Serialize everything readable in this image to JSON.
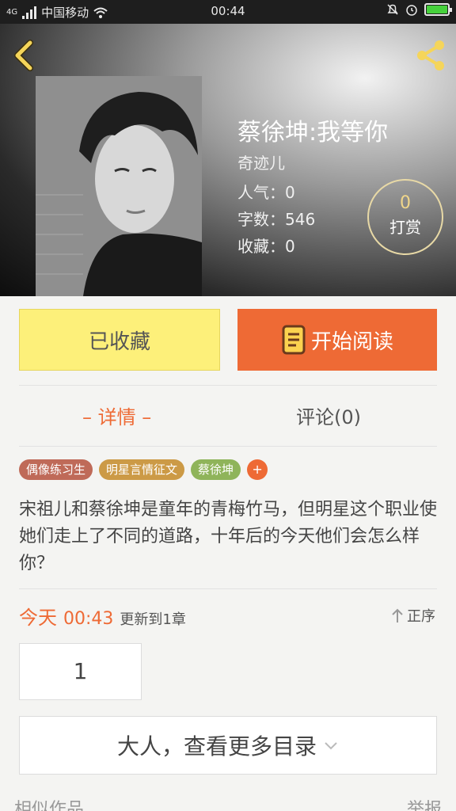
{
  "status_bar": {
    "network": "4G",
    "carrier": "中国移动",
    "time": "00:44"
  },
  "book": {
    "title": "蔡徐坤:我等你",
    "author": "奇迹儿",
    "popularity": "人气：0",
    "word_count": "字数：546",
    "favorites": "收藏：0",
    "tip_count": "0",
    "tip_label": "打赏"
  },
  "actions": {
    "favorite_label": "已收藏",
    "read_label": "开始阅读"
  },
  "tabs": {
    "detail": "– 详情 –",
    "comments": "评论(0)"
  },
  "tags": [
    "偶像练习生",
    "明星言情征文",
    "蔡徐坤"
  ],
  "tag_add": "+",
  "description": "宋祖儿和蔡徐坤是童年的青梅竹马，但明星这个职业使她们走上了不同的道路，十年后的今天他们会怎么样你？",
  "update": {
    "day": "今天",
    "time": "00:43",
    "text": "更新到1章",
    "order_label": "正序"
  },
  "chapters": [
    "1"
  ],
  "more_catalog": "大人，查看更多目录",
  "footer": {
    "left": "相似作品",
    "right": "举报"
  },
  "colors": {
    "accent": "#ee6a35",
    "favorite_bg": "#fdf07a",
    "header_icon": "#f5d55a"
  },
  "icons": [
    "back-arrow-icon",
    "share-icon",
    "book-icon",
    "arrow-up-icon",
    "chevron-down-icon",
    "wifi-icon",
    "alarm-icon",
    "battery-icon"
  ]
}
